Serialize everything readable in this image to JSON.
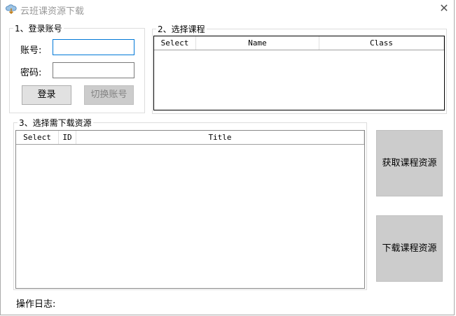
{
  "window": {
    "title": "云班课资源下载",
    "close_label": "✕"
  },
  "login": {
    "legend": "1、登录账号",
    "account_label": "账号:",
    "account_value": "",
    "password_label": "密码:",
    "password_value": "",
    "login_button": "登录",
    "switch_button": "切换账号"
  },
  "courses": {
    "legend": "2、选择课程",
    "columns": [
      "Select",
      "Name",
      "Class"
    ]
  },
  "resources": {
    "legend": "3、选择需下载资源",
    "columns": [
      "Select",
      "ID",
      "Title"
    ]
  },
  "actions": {
    "fetch_button": "获取课程资源",
    "download_button": "下载课程资源"
  },
  "log": {
    "label": "操作日志:"
  }
}
